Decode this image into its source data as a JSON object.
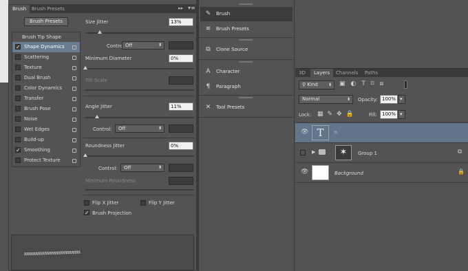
{
  "brush_panel": {
    "tabs": [
      "Brush",
      "Brush Presets"
    ],
    "brush_presets_button": "Brush Presets",
    "list_header": "Brush Tip Shape",
    "list_items": [
      {
        "label": "Shape Dynamics",
        "checked": true,
        "selected": true
      },
      {
        "label": "Scattering",
        "checked": false,
        "selected": false
      },
      {
        "label": "Texture",
        "checked": false,
        "selected": false
      },
      {
        "label": "Dual Brush",
        "checked": false,
        "selected": false
      },
      {
        "label": "Color Dynamics",
        "checked": false,
        "selected": false
      },
      {
        "label": "Transfer",
        "checked": false,
        "selected": false
      },
      {
        "label": "Brush Pose",
        "checked": false,
        "selected": false
      },
      {
        "label": "Noise",
        "checked": false,
        "selected": false
      },
      {
        "label": "Wet Edges",
        "checked": false,
        "selected": false
      },
      {
        "label": "Build-up",
        "checked": false,
        "selected": false
      },
      {
        "label": "Smoothing",
        "checked": true,
        "selected": false
      },
      {
        "label": "Protect Texture",
        "checked": false,
        "selected": false
      }
    ],
    "size_jitter": {
      "label": "Size Jitter",
      "value": "13%",
      "fraction": 0.13
    },
    "control_1": {
      "label": "Control:",
      "value": "Off"
    },
    "minimum_diameter": {
      "label": "Minimum Diameter",
      "value": "0%",
      "fraction": 0.0
    },
    "tilt_scale": {
      "label": "Tilt Scale"
    },
    "angle_jitter": {
      "label": "Angle Jitter",
      "value": "11%",
      "fraction": 0.11
    },
    "control_2": {
      "label": "Control:",
      "value": "Off"
    },
    "roundness_jitter": {
      "label": "Roundness Jitter",
      "value": "0%",
      "fraction": 0.0
    },
    "control_3": {
      "label": "Control:",
      "value": "Off"
    },
    "minimum_roundness": {
      "label": "Minimum Roundness"
    },
    "flip_x": {
      "label": "Flip X Jitter",
      "checked": false
    },
    "flip_y": {
      "label": "Flip Y Jitter",
      "checked": false
    },
    "brush_projection": {
      "label": "Brush Projection",
      "checked": true
    },
    "preview_stroke": "ᥰᥰᥰᥰᥰᥰᥰᥰᥰᥰᥰᥰᥰᥰᥰᥰᥰᥰᥰᥰᥰᥰᥰᥰᥰ"
  },
  "tools_panel": {
    "items": [
      {
        "label": "Brush",
        "icon": "brush-icon",
        "glyph": "✎",
        "selected": true
      },
      {
        "label": "Brush Presets",
        "icon": "brush-presets-icon",
        "glyph": "≋",
        "selected": false
      },
      {
        "label": "Clone Source",
        "icon": "clone-source-icon",
        "glyph": "⧉",
        "selected": false
      },
      {
        "label": "Character",
        "icon": "character-icon",
        "glyph": "A",
        "selected": false
      },
      {
        "label": "Paragraph",
        "icon": "paragraph-icon",
        "glyph": "¶",
        "selected": false
      },
      {
        "label": "Tool Presets",
        "icon": "tool-presets-icon",
        "glyph": "✕",
        "selected": false
      }
    ]
  },
  "layers_panel": {
    "tabs": [
      "3D",
      "Layers",
      "Channels",
      "Paths"
    ],
    "active_tab": "Layers",
    "filter_kind": "Kind",
    "blend_mode": "Normal",
    "opacity_label": "Opacity:",
    "opacity_value": "100%",
    "lock_label": "Lock:",
    "fill_label": "Fill:",
    "fill_value": "100%",
    "layers": [
      {
        "name": "n",
        "type": "text",
        "visible": true,
        "selected": true,
        "thumb": "T"
      },
      {
        "name": "Group 1",
        "type": "group",
        "visible": false,
        "selected": false
      },
      {
        "name": "Background",
        "type": "background",
        "visible": true,
        "selected": false
      }
    ]
  },
  "colors": {
    "panel_bg": "#535353",
    "selection_blue": "#64758a",
    "dark_border": "#3a3a3a"
  }
}
